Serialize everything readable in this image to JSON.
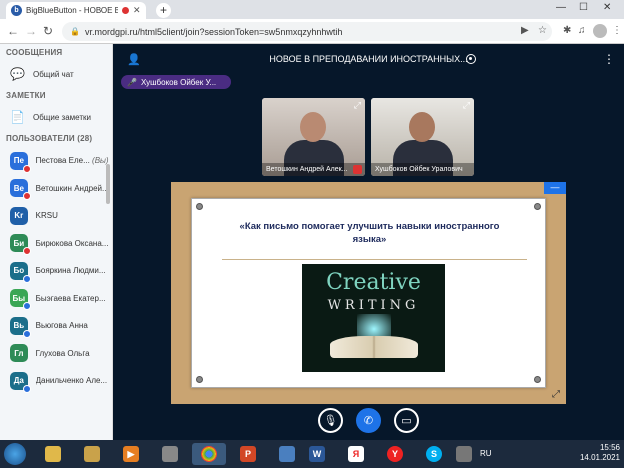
{
  "browser": {
    "tab_title": "BigBlueButton - НОВОЕ В ПР",
    "favicon_letter": "b",
    "url": "vr.mordgpi.ru/html5client/join?sessionToken=sw5nmxqzyhnhwtih"
  },
  "sidebar": {
    "messages_header": "СООБЩЕНИЯ",
    "public_chat": "Общий чат",
    "notes_header": "ЗАМЕТКИ",
    "shared_notes": "Общие заметки",
    "users_header": "ПОЛЬЗОВАТЕЛИ (28)",
    "users": [
      {
        "initials": "Пе",
        "name": "Пестова Еле...",
        "suffix": "(Вы)",
        "color": "#2a6fdb",
        "badge": "#d33"
      },
      {
        "initials": "Ве",
        "name": "Ветошкин Андрей...",
        "suffix": "",
        "color": "#2a6fdb",
        "badge": "#d33"
      },
      {
        "initials": "Kr",
        "name": "KRSU",
        "suffix": "",
        "color": "#1f5fa8",
        "badge": ""
      },
      {
        "initials": "Би",
        "name": "Бирюкова Оксана...",
        "suffix": "",
        "color": "#2e8b57",
        "badge": "#d33"
      },
      {
        "initials": "Бо",
        "name": "Бояркина Людми...",
        "suffix": "",
        "color": "#1b6e8a",
        "badge": "#2a6fdb"
      },
      {
        "initials": "Бы",
        "name": "Быэгаева Екатер...",
        "suffix": "",
        "color": "#3aa655",
        "badge": "#2a6fdb"
      },
      {
        "initials": "Вь",
        "name": "Вьюгова Анна",
        "suffix": "",
        "color": "#1b6e8a",
        "badge": "#2a6fdb"
      },
      {
        "initials": "Гл",
        "name": "Глухова Ольга",
        "suffix": "",
        "color": "#2e8b57",
        "badge": ""
      },
      {
        "initials": "Да",
        "name": "Данильченко Але...",
        "suffix": "",
        "color": "#1b6e8a",
        "badge": "#2a6fdb"
      }
    ]
  },
  "main": {
    "presenter_name": "Хушбоков Ойбек У...",
    "meeting_title": "НОВОЕ В ПРЕПОДАВАНИИ ИНОСТРАННЫХ...",
    "videos": [
      {
        "caption": "Ветошкин Андрей Алек..."
      },
      {
        "caption": "Хушбоков Ойбек Уралович"
      }
    ],
    "slide": {
      "heading": "«Как письмо помогает улучшить навыки иностранного языка»",
      "image_word_1": "Creative",
      "image_word_2": "WRITING"
    }
  },
  "taskbar": {
    "language": "RU",
    "time": "15:56",
    "date": "14.01.2021"
  }
}
